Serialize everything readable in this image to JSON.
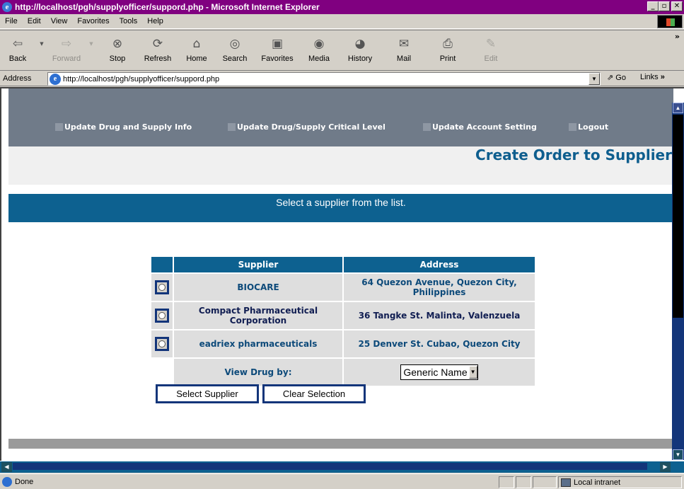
{
  "window": {
    "title": "http://localhost/pgh/supplyofficer/suppord.php - Microsoft Internet Explorer",
    "controls": {
      "minimize": "_",
      "maximize": "▫",
      "close": "✕"
    }
  },
  "menu": [
    "File",
    "Edit",
    "View",
    "Favorites",
    "Tools",
    "Help"
  ],
  "toolbar": {
    "buttons": [
      {
        "label": "Back",
        "icon": "back-arrow-icon",
        "enabled": true
      },
      {
        "label": "Forward",
        "icon": "forward-arrow-icon",
        "enabled": false
      },
      {
        "label": "Stop",
        "icon": "stop-icon",
        "enabled": true
      },
      {
        "label": "Refresh",
        "icon": "refresh-icon",
        "enabled": true
      },
      {
        "label": "Home",
        "icon": "home-icon",
        "enabled": true
      },
      {
        "label": "Search",
        "icon": "search-icon",
        "enabled": true
      },
      {
        "label": "Favorites",
        "icon": "favorites-icon",
        "enabled": true
      },
      {
        "label": "Media",
        "icon": "media-icon",
        "enabled": true
      },
      {
        "label": "History",
        "icon": "history-icon",
        "enabled": true
      },
      {
        "label": "Mail",
        "icon": "mail-icon",
        "enabled": true
      },
      {
        "label": "Print",
        "icon": "print-icon",
        "enabled": true
      },
      {
        "label": "Edit",
        "icon": "edit-icon",
        "enabled": false
      }
    ]
  },
  "address": {
    "label": "Address",
    "url": "http://localhost/pgh/supplyofficer/suppord.php",
    "go": "Go",
    "links": "Links"
  },
  "nav": {
    "items": [
      "Update Drug and Supply Info",
      "Update Drug/Supply Critical Level",
      "Update Account Setting",
      "Logout"
    ]
  },
  "page": {
    "title": "Create Order to Supplier",
    "instruction": "Select a supplier from the list."
  },
  "table": {
    "headers": [
      "Supplier",
      "Address"
    ],
    "rows": [
      {
        "supplier": "BIOCARE",
        "address": "64 Quezon Avenue, Quezon City, Philippines"
      },
      {
        "supplier": "Compact Pharmaceutical Corporation",
        "address": "36 Tangke St. Malinta, Valenzuela"
      },
      {
        "supplier": "eadriex pharmaceuticals",
        "address": "25 Denver St. Cubao, Quezon City"
      }
    ],
    "view_label": "View Drug by:",
    "view_value": "Generic Name"
  },
  "buttons": {
    "select": "Select Supplier",
    "clear": "Clear Selection"
  },
  "status": {
    "text": "Done",
    "zone": "Local intranet"
  },
  "colors": {
    "titlebar": "#800080",
    "nav_band": "#707b89",
    "accent_blue": "#0d6190",
    "title_text": "#0e5e8e",
    "scrollbar": "#13357a"
  }
}
